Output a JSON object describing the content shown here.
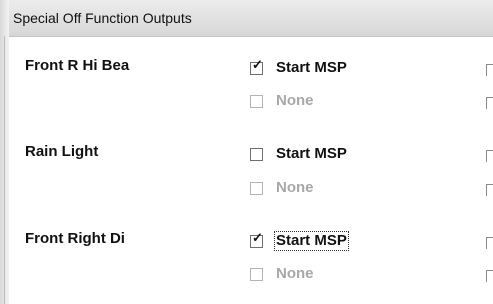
{
  "window": {
    "title": "Special Off Function Outputs"
  },
  "rows": [
    {
      "label": "Front R Hi Bea",
      "primary": {
        "label": "Start MSP",
        "checked": true,
        "enabled": true
      },
      "secondary": {
        "label": "None",
        "checked": false,
        "enabled": false
      }
    },
    {
      "label": "Rain Light",
      "primary": {
        "label": "Start MSP",
        "checked": false,
        "enabled": true
      },
      "secondary": {
        "label": "None",
        "checked": false,
        "enabled": false
      }
    },
    {
      "label": "Front Right Di",
      "primary": {
        "label": "Start MSP",
        "checked": true,
        "enabled": true,
        "focused": true
      },
      "secondary": {
        "label": "None",
        "checked": false,
        "enabled": false
      }
    }
  ],
  "icons": {
    "checkmark": "checkmark-icon"
  }
}
